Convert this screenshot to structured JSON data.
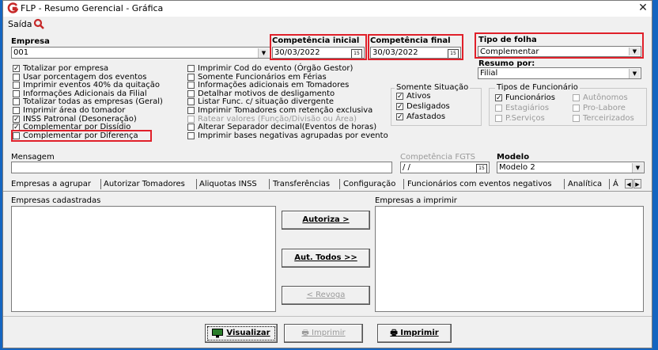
{
  "window": {
    "title": "FLP - Resumo Gerencial - Gráfica",
    "close": "✕"
  },
  "menu": {
    "saida": "Saída"
  },
  "empresa": {
    "label": "Empresa",
    "value": "001"
  },
  "competencia_inicial": {
    "label": "Competência inicial",
    "value": "30/03/2022"
  },
  "competencia_final": {
    "label": "Competência final",
    "value": "30/03/2022"
  },
  "tipo_folha": {
    "label": "Tipo de folha",
    "value": "Complementar"
  },
  "resumo_por": {
    "label": "Resumo por:",
    "value": "Filial"
  },
  "options_left": [
    {
      "label": "Totalizar por empresa",
      "checked": true
    },
    {
      "label": "Usar porcentagem dos eventos",
      "checked": false
    },
    {
      "label": "Imprimir eventos 40% da quitação",
      "checked": false
    },
    {
      "label": "Informações Adicionais da Filial",
      "checked": false
    },
    {
      "label": "Totalizar todas as empresas (Geral)",
      "checked": false
    },
    {
      "label": "Imprimir área do tomador",
      "checked": false
    },
    {
      "label": "INSS Patronal (Desoneração)",
      "checked": true
    },
    {
      "label": "Complementar por Dissídio",
      "checked": true
    },
    {
      "label": "Complementar por Diferença",
      "checked": false
    }
  ],
  "options_mid": [
    {
      "label": "Imprimir Cod do evento (Órgão Gestor)",
      "checked": false,
      "disabled": false
    },
    {
      "label": "Somente Funcionários em Férias",
      "checked": false,
      "disabled": false
    },
    {
      "label": "Informações adicionais em Tomadores",
      "checked": false,
      "disabled": false
    },
    {
      "label": "Detalhar motivos de desligamento",
      "checked": false,
      "disabled": false
    },
    {
      "label": "Listar Func. c/ situação divergente",
      "checked": false,
      "disabled": false
    },
    {
      "label": "Imprimir Tomadores com retenção exclusiva",
      "checked": false,
      "disabled": false
    },
    {
      "label": "Ratear valores (Função/Divisão ou Área)",
      "checked": false,
      "disabled": true
    },
    {
      "label": "Alterar Separador decimal(Eventos de horas)",
      "checked": false,
      "disabled": false
    },
    {
      "label": "Imprimir bases negativas agrupadas por evento",
      "checked": false,
      "disabled": false
    }
  ],
  "somente_situacao": {
    "title": "Somente Situação",
    "items": [
      {
        "label": "Ativos",
        "checked": true
      },
      {
        "label": "Desligados",
        "checked": true
      },
      {
        "label": "Afastados",
        "checked": true
      }
    ]
  },
  "tipos_funcionario": {
    "title": "Tipos de Funcionário",
    "items": [
      {
        "label": "Funcionários",
        "checked": true,
        "disabled": false
      },
      {
        "label": "Autônomos",
        "checked": false,
        "disabled": true
      },
      {
        "label": "Estagiários",
        "checked": false,
        "disabled": true
      },
      {
        "label": "Pro-Labore",
        "checked": false,
        "disabled": true
      },
      {
        "label": "P.Serviços",
        "checked": false,
        "disabled": true
      },
      {
        "label": "Terceirizados",
        "checked": false,
        "disabled": true
      }
    ]
  },
  "mensagem": {
    "label": "Mensagem",
    "value": ""
  },
  "competencia_fgts": {
    "label": "Competência FGTS",
    "value": " /  /"
  },
  "modelo": {
    "label": "Modelo",
    "value": "Modelo 2"
  },
  "tabs": [
    "Empresas a agrupar",
    "Autorizar Tomadores",
    "Aliquotas INSS",
    "Transferências",
    "Configuração",
    "Funcionários com eventos negativos",
    "Analítica",
    "Á"
  ],
  "lists": {
    "left_title": "Empresas cadastradas",
    "right_title": "Empresas a imprimir"
  },
  "buttons": {
    "autoriza": "Autoriza >",
    "aut_todos": "Aut. Todos >>",
    "revoga": "< Revoga",
    "visualizar": "Visualizar",
    "imprimir_dis": "Imprimir",
    "imprimir": "Imprimir"
  },
  "colors": {
    "highlight": "#e0202a",
    "desktop": "#1565c0",
    "brand": "#c62828"
  }
}
